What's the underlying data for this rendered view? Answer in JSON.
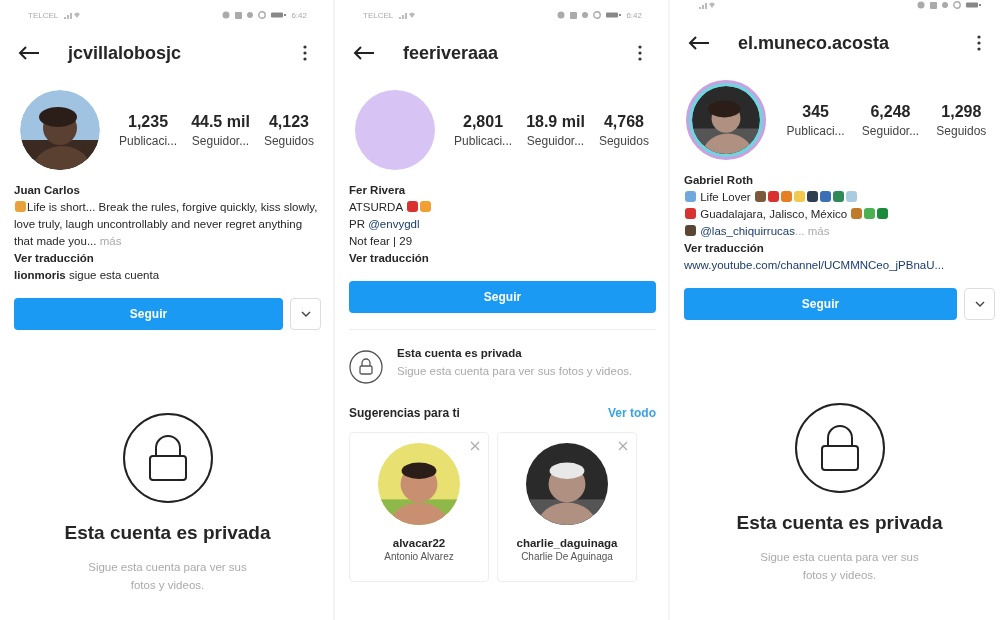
{
  "screens": [
    {
      "status": {
        "carrier": "TELCEL",
        "time": "6:42"
      },
      "username": "jcvillalobosjc",
      "avatar": {
        "kind": "picture"
      },
      "stats": [
        {
          "value": "1,235",
          "label": "Publicaci..."
        },
        {
          "value": "44.5 mil",
          "label": "Seguidor..."
        },
        {
          "value": "4,123",
          "label": "Seguidos"
        }
      ],
      "bio": {
        "name": "Juan Carlos",
        "lines": [
          [
            {
              "kind": "emoji",
              "color": "#e9a23b"
            },
            {
              "kind": "text",
              "text": "Life is short... Break the rules, forgive quickly, kiss slowly, love truly, laugh uncontrollably and never regret anything that made you..."
            },
            {
              "kind": "more",
              "text": " más"
            }
          ],
          [
            {
              "kind": "translate",
              "text": "Ver traducción"
            }
          ],
          [
            {
              "kind": "bold",
              "text": "lionmoris"
            },
            {
              "kind": "text",
              "text": " sigue esta cuenta"
            }
          ]
        ]
      },
      "follow": {
        "label": "Seguir",
        "dropdown": true
      },
      "private": {
        "kind": "large",
        "title": "Esta cuenta es privada",
        "text": "Sigue esta cuenta para ver sus fotos y videos."
      }
    },
    {
      "status": {
        "carrier": "TELCEL",
        "time": "6:42"
      },
      "username": "feeriveraaa",
      "avatar": {
        "kind": "blank",
        "color": "#d8c3f5"
      },
      "stats": [
        {
          "value": "2,801",
          "label": "Publicaci..."
        },
        {
          "value": "18.9 mil",
          "label": "Seguidor..."
        },
        {
          "value": "4,768",
          "label": "Seguidos"
        }
      ],
      "bio": {
        "name": "Fer Rivera",
        "lines": [
          [
            {
              "kind": "text",
              "text": "ATSURDA "
            },
            {
              "kind": "emoji",
              "color": "#d9312f"
            },
            {
              "kind": "emoji",
              "color": "#f0a030"
            }
          ],
          [
            {
              "kind": "text",
              "text": "PR "
            },
            {
              "kind": "link",
              "text": "@envygdl"
            }
          ],
          [
            {
              "kind": "text",
              "text": "Not fear | 29"
            }
          ],
          [
            {
              "kind": "translate",
              "text": "Ver traducción"
            }
          ]
        ]
      },
      "follow": {
        "label": "Seguir",
        "dropdown": false
      },
      "private": {
        "kind": "inline",
        "title": "Esta cuenta es privada",
        "text": "Sigue esta cuenta para ver sus fotos y videos."
      },
      "suggestions": {
        "title": "Sugerencias para ti",
        "action": "Ver todo",
        "cards": [
          {
            "username": "alvacar22",
            "name": "Antonio Alvarez"
          },
          {
            "username": "charlie_daguinaga",
            "name": "Charlie De Aguinaga"
          }
        ]
      }
    },
    {
      "username": "el.muneco.acosta",
      "avatar": {
        "kind": "story-picture"
      },
      "stats": [
        {
          "value": "345",
          "label": "Publicaci..."
        },
        {
          "value": "6,248",
          "label": "Seguidor..."
        },
        {
          "value": "1,298",
          "label": "Seguidos"
        }
      ],
      "bio": {
        "name": "Gabriel Roth",
        "lines": [
          [
            {
              "kind": "emoji",
              "color": "#6fa8dc"
            },
            {
              "kind": "text",
              "text": " Life Lover "
            },
            {
              "kind": "emoji",
              "color": "#7a5a3a"
            },
            {
              "kind": "emoji",
              "color": "#d9312f"
            },
            {
              "kind": "emoji",
              "color": "#e67e22"
            },
            {
              "kind": "emoji",
              "color": "#f2c94c"
            },
            {
              "kind": "emoji",
              "color": "#2d3e50"
            },
            {
              "kind": "emoji",
              "color": "#3b6fb6"
            },
            {
              "kind": "emoji",
              "color": "#2e8b57"
            },
            {
              "kind": "emoji",
              "color": "#a9cce3"
            }
          ],
          [
            {
              "kind": "emoji",
              "color": "#d9312f"
            },
            {
              "kind": "text",
              "text": " Guadalajara, Jalisco, México "
            },
            {
              "kind": "emoji",
              "color": "#c07a2c"
            },
            {
              "kind": "emoji",
              "color": "#4caf50"
            },
            {
              "kind": "emoji",
              "color": "#1b8a3a"
            }
          ],
          [
            {
              "kind": "emoji",
              "color": "#5b4636"
            },
            {
              "kind": "link",
              "text": " @las_chiquirrucas"
            },
            {
              "kind": "more",
              "text": "... más"
            }
          ],
          [
            {
              "kind": "translate",
              "text": "Ver traducción"
            }
          ],
          [
            {
              "kind": "link",
              "text": "www.youtube.com/channel/UCMMNCeo_jPBnaU..."
            }
          ]
        ]
      },
      "follow": {
        "label": "Seguir",
        "dropdown": true
      },
      "private": {
        "kind": "large",
        "title": "Esta cuenta es privada",
        "text": "Sigue esta cuenta para ver sus fotos y videos."
      }
    }
  ]
}
